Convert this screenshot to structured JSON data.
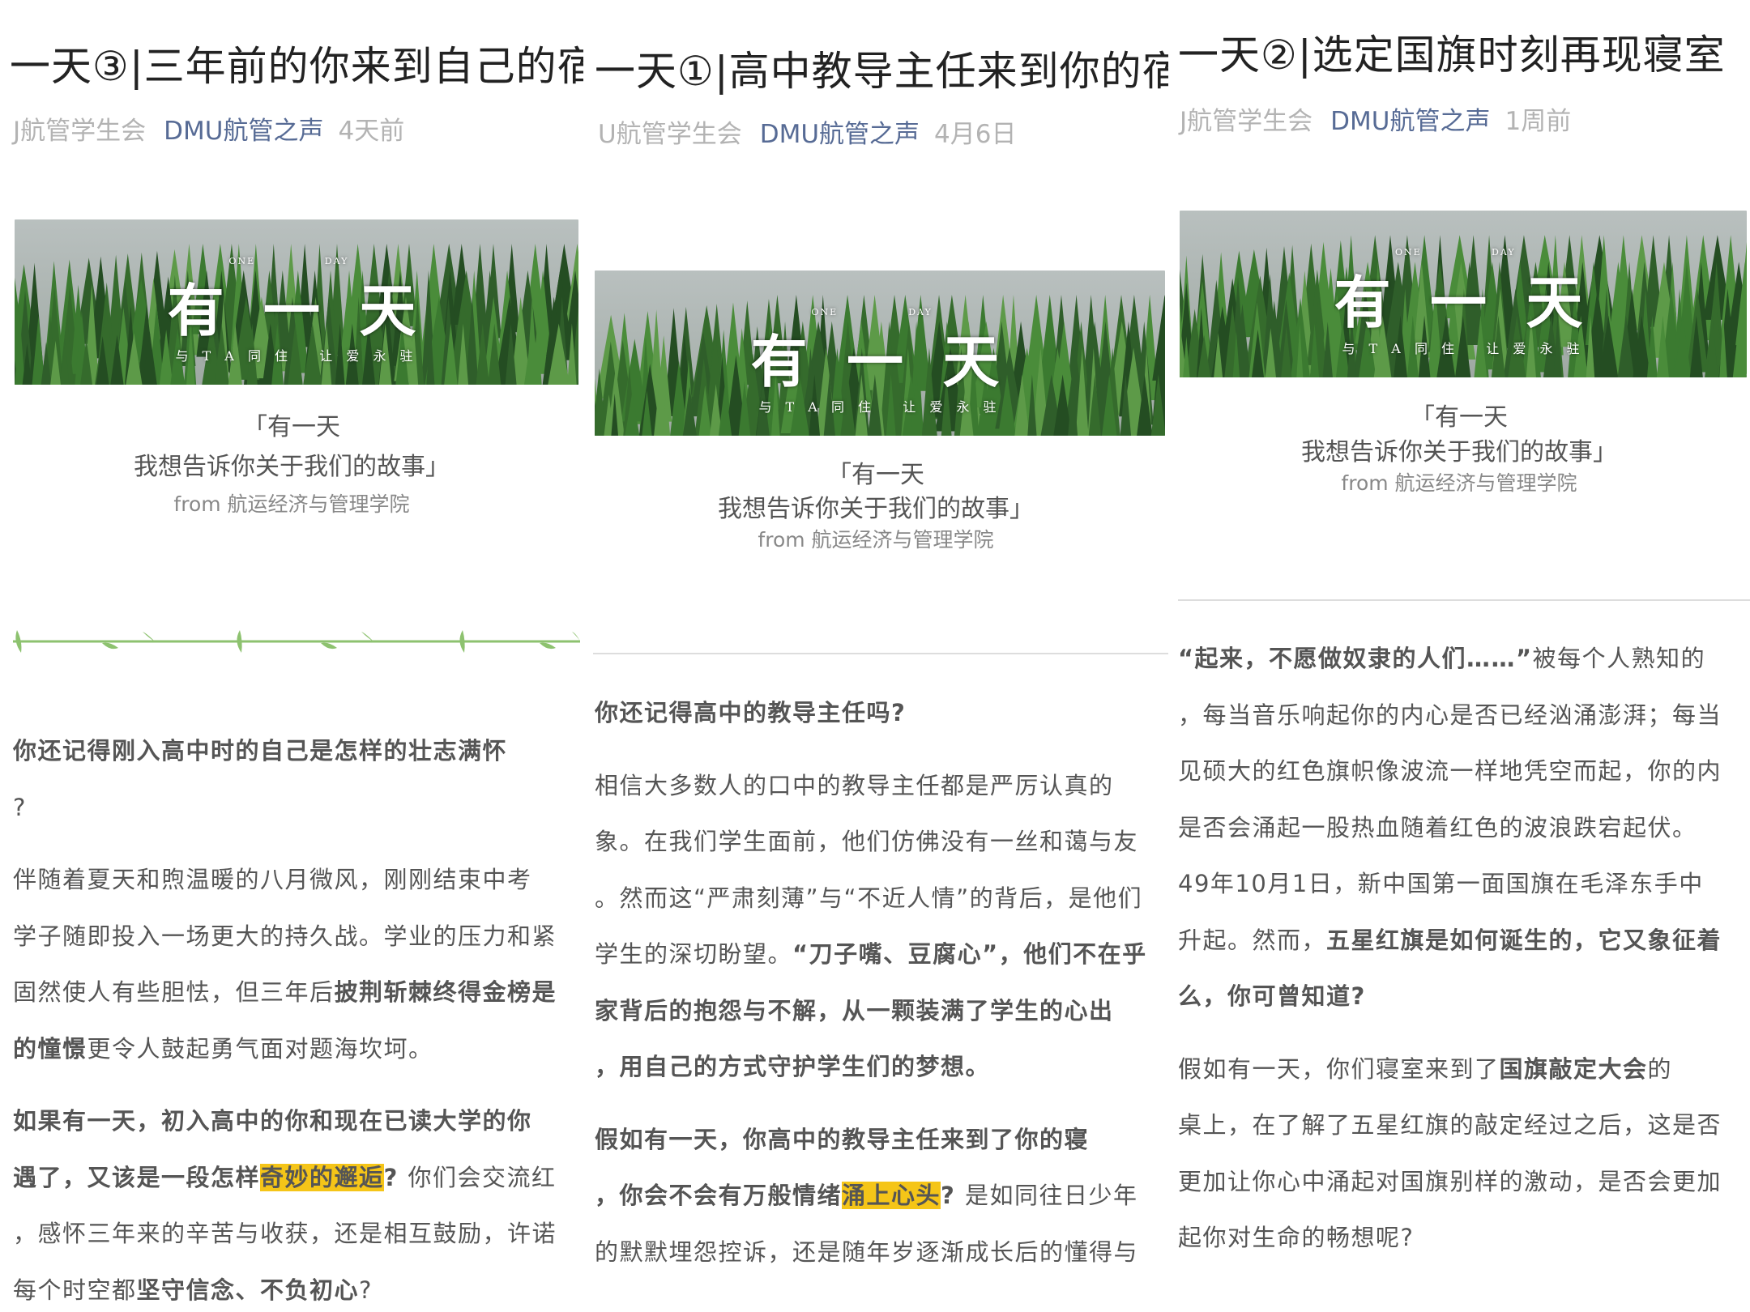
{
  "panels": [
    {
      "title": "一天③|三年前的你来到自己的宿",
      "meta": {
        "source": "J航管学生会",
        "account": "DMU航管之声",
        "time": "4天前"
      },
      "banner": {
        "en_one": "ONE",
        "en_day": "DAY",
        "big": "有 一 天",
        "sub": "与 T A 同 住   让 爱 永 驻"
      },
      "caption": {
        "line1": "「有一天",
        "line2": "我想告诉你关于我们的故事」",
        "line3": "from 航运经济与管理学院"
      },
      "paragraphs": [
        [
          [
            {
              "t": "你还记得刚入高中时的自己是怎样的壮志满怀",
              "b": true
            }
          ],
          [
            {
              "t": "?"
            }
          ]
        ],
        [
          [
            {
              "t": "伴随着夏天和煦温暖的八月微风，刚刚结束中考"
            }
          ],
          [
            {
              "t": "学子随即投入一场更大的持久战。学业的压力和紧"
            }
          ],
          [
            {
              "t": "固然使人有些胆怯，但三年后"
            },
            {
              "t": "披荆斩棘终得金榜是",
              "b": true
            }
          ],
          [
            {
              "t": "的憧憬",
              "b": true
            },
            {
              "t": "更令人鼓起勇气面对题海坎坷。"
            }
          ]
        ],
        [
          [
            {
              "t": "如果有一天，初入高中的你和现在已读大学的你",
              "b": true
            }
          ],
          [
            {
              "t": "遇了，又该是一段怎样",
              "b": true
            },
            {
              "t": "奇妙的邂逅",
              "h": true
            },
            {
              "t": "? ",
              "b": true
            },
            {
              "t": "你们会交流红"
            }
          ],
          [
            {
              "t": "，感怀三年来的辛苦与收获，还是相互鼓励，许诺"
            }
          ],
          [
            {
              "t": "每个时空都"
            },
            {
              "t": "坚守信念、不负初心",
              "b": true
            },
            {
              "t": "?"
            }
          ]
        ]
      ]
    },
    {
      "title": "一天①|高中教导主任来到你的宿",
      "meta": {
        "source": "U航管学生会",
        "account": "DMU航管之声",
        "time": "4月6日"
      },
      "banner": {
        "en_one": "ONE",
        "en_day": "DAY",
        "big": "有 一 天",
        "sub": "与 T A 同 住   让 爱 永 驻"
      },
      "caption": {
        "line1": "「有一天",
        "line2": "我想告诉你关于我们的故事」",
        "line3": "from 航运经济与管理学院"
      },
      "paragraphs": [
        [
          [
            {
              "t": "你还记得高中的教导主任吗?",
              "b": true
            }
          ]
        ],
        [
          [
            {
              "t": "相信大多数人的口中的教导主任都是严厉认真的"
            }
          ],
          [
            {
              "t": "象。在我们学生面前，他们仿佛没有一丝和蔼与友"
            }
          ],
          [
            {
              "t": "。然而这“严肃刻薄”与“不近人情”的背后，是他们"
            }
          ],
          [
            {
              "t": "学生的深切盼望。"
            },
            {
              "t": "“刀子嘴、豆腐心”，他们不在乎",
              "b": true
            }
          ],
          [
            {
              "t": "家背后的抱怨与不解，从一颗装满了学生的心出",
              "b": true
            }
          ],
          [
            {
              "t": "，用自己的方式守护学生们的梦想。",
              "b": true
            }
          ]
        ],
        [
          [
            {
              "t": "假如有一天，你高中的教导主任来到了你的寝",
              "b": true
            }
          ],
          [
            {
              "t": "，你会不会有万般情绪",
              "b": true
            },
            {
              "t": "涌上心头",
              "h": true
            },
            {
              "t": "? ",
              "b": true
            },
            {
              "t": "是如同往日少年"
            }
          ],
          [
            {
              "t": "的默默埋怨控诉，还是随年岁逐渐成长后的懂得与"
            }
          ]
        ]
      ]
    },
    {
      "title": "一天②|选定国旗时刻再现寝室",
      "meta": {
        "source": "J航管学生会",
        "account": "DMU航管之声",
        "time": "1周前"
      },
      "banner": {
        "en_one": "ONE",
        "en_day": "DAY",
        "big": "有 一 天",
        "sub": "与 T A 同 住   让 爱 永 驻"
      },
      "caption": {
        "line1": "「有一天",
        "line2": "我想告诉你关于我们的故事」",
        "line3": "from 航运经济与管理学院"
      },
      "paragraphs": [
        [
          [
            {
              "t": "“起来，不愿做奴隶的人们……”",
              "b": true
            },
            {
              "t": "被每个人熟知的"
            }
          ],
          [
            {
              "t": "，每当音乐响起你的内心是否已经汹涌澎湃；每当"
            }
          ],
          [
            {
              "t": "见硕大的红色旗帜像波流一样地凭空而起，你的内"
            }
          ],
          [
            {
              "t": "是否会涌起一股热血随着红色的波浪跌宕起伏。"
            }
          ],
          [
            {
              "t": "49年10月1日，新中国第一面国旗在毛泽东手中"
            }
          ],
          [
            {
              "t": "升起。然而，"
            },
            {
              "t": "五星红旗是如何诞生的，它又象征着",
              "b": true
            }
          ],
          [
            {
              "t": "么，你可曾知道?",
              "b": true
            }
          ]
        ],
        [
          [
            {
              "t": "假如有一天，你们寝室来到了"
            },
            {
              "t": "国旗敲定大会",
              "b": true
            },
            {
              "t": "的"
            }
          ],
          [
            {
              "t": "桌上，在了解了五星红旗的敲定经过之后，这是否"
            }
          ],
          [
            {
              "t": "更加让你心中涌起对国旗别样的激动，是否会更加"
            }
          ],
          [
            {
              "t": "起你对生命的畅想呢?"
            }
          ]
        ]
      ]
    }
  ],
  "colors": {
    "accent": "#576b95",
    "highlight": "#f5c518",
    "meta": "#b3b3b3",
    "vine": "#8dc26f"
  }
}
